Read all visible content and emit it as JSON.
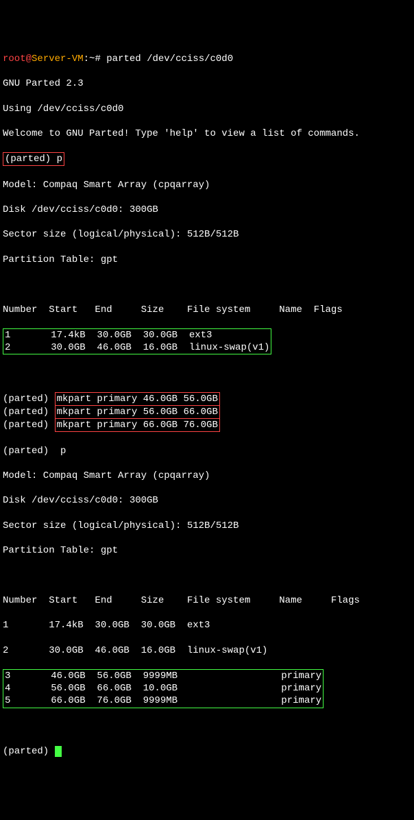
{
  "prompt": {
    "user": "root",
    "at": "@",
    "host": "Server-VM",
    "colon_path": ":~",
    "hash": "# ",
    "command": "parted /dev/cciss/c0d0"
  },
  "intro": {
    "version": "GNU Parted 2.3",
    "using": "Using /dev/cciss/c0d0",
    "welcome": "Welcome to GNU Parted! Type 'help' to view a list of commands."
  },
  "parted_p1": "(parted) p",
  "model": "Model: Compaq Smart Array (cpqarray)",
  "disk": "Disk /dev/cciss/c0d0: 300GB",
  "sector": "Sector size (logical/physical): 512B/512B",
  "ptable": "Partition Table: gpt",
  "table1": {
    "header": "Number  Start   End     Size    File system     Name  Flags",
    "row1": "1       17.4kB  30.0GB  30.0GB  ext3",
    "row2": "2       30.0GB  46.0GB  16.0GB  linux-swap(v1)"
  },
  "mkpart": {
    "prefix": "(parted) ",
    "cmd1": "mkpart primary 46.0GB 56.0GB",
    "cmd2": "mkpart primary 56.0GB 66.0GB",
    "cmd3": "mkpart primary 66.0GB 76.0GB"
  },
  "parted_p2": "(parted)  p",
  "table2": {
    "header": "Number  Start   End     Size    File system     Name     Flags",
    "row1": "1       17.4kB  30.0GB  30.0GB  ext3",
    "row2": "2       30.0GB  46.0GB  16.0GB  linux-swap(v1)",
    "row3": "3       46.0GB  56.0GB  9999MB                  primary",
    "row4": "4       56.0GB  66.0GB  10.0GB                  primary",
    "row5": "5       66.0GB  76.0GB  9999MB                  primary"
  },
  "parted_end": "(parted) "
}
